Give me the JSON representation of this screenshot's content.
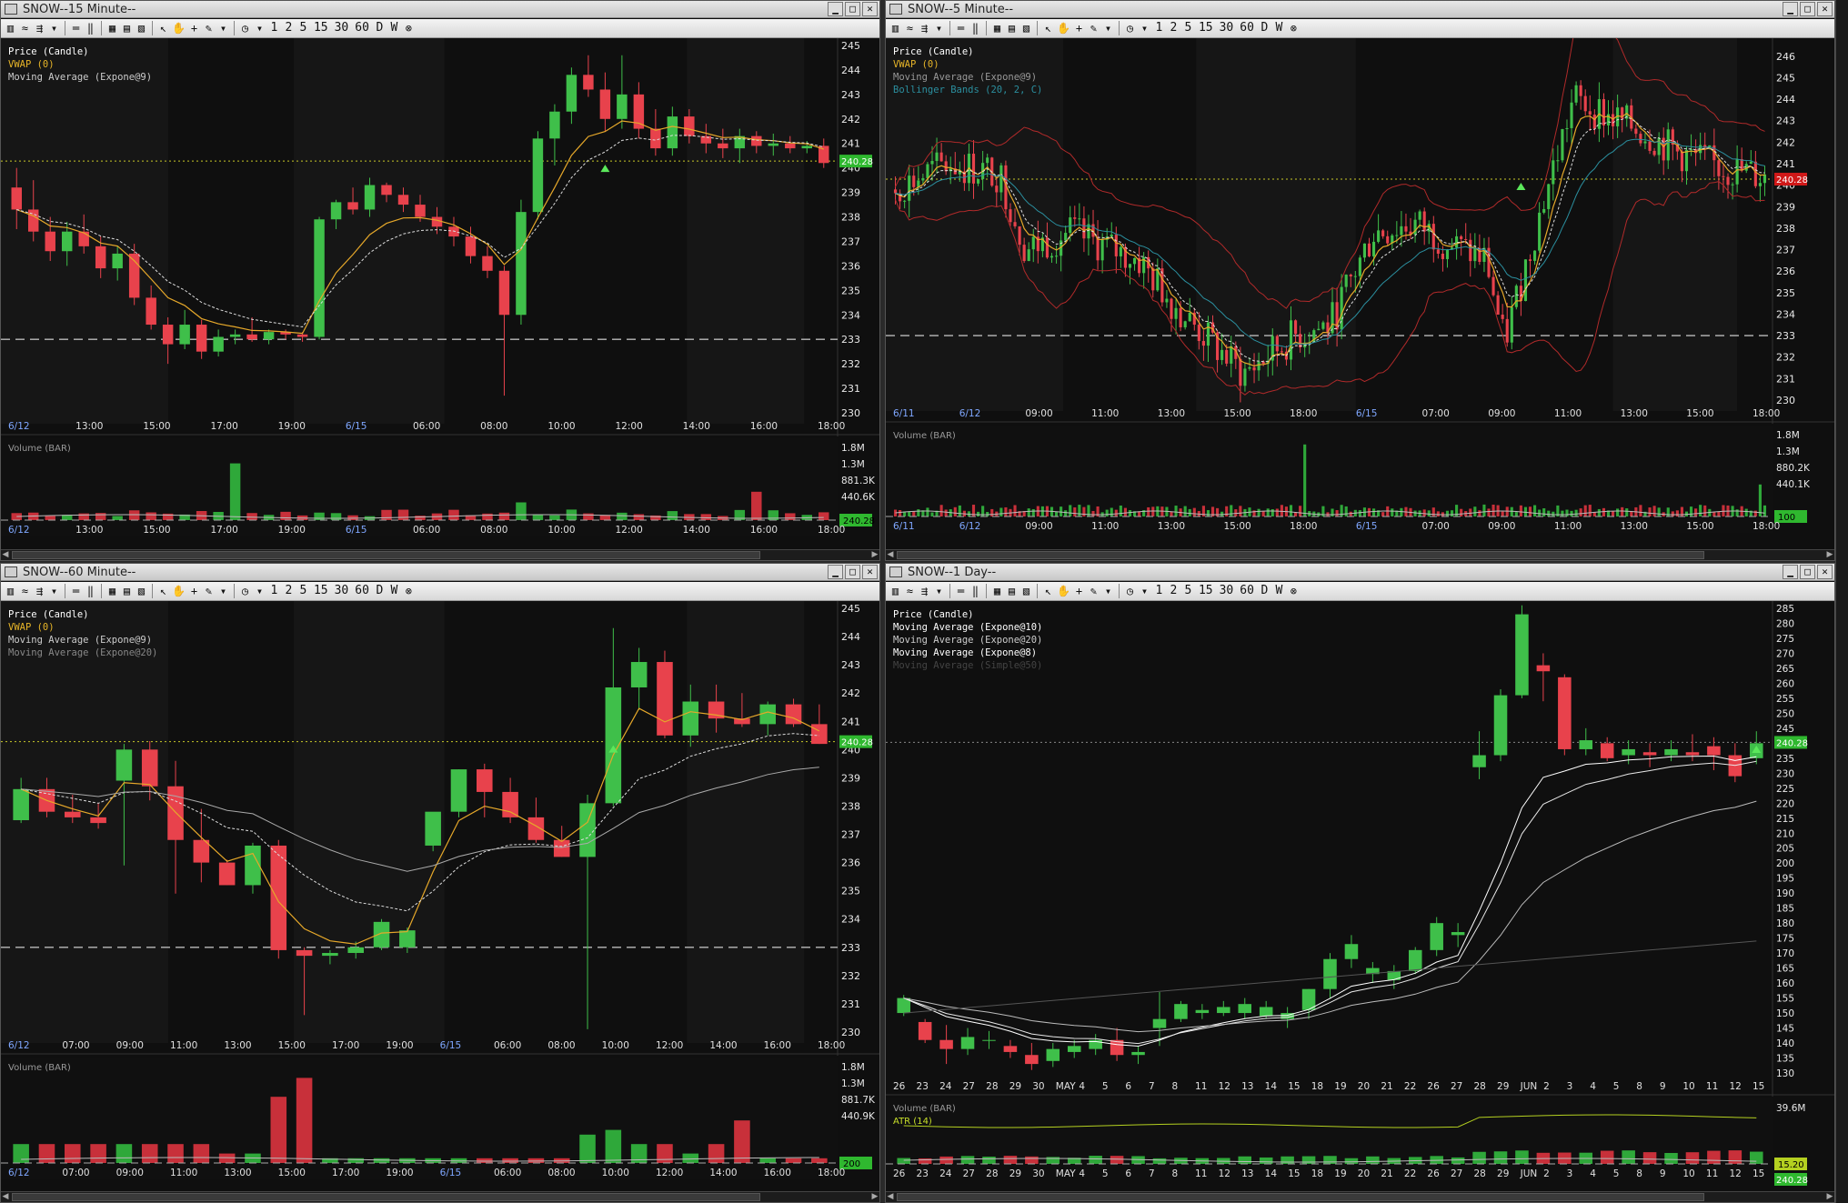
{
  "toolbar": {
    "intervals": [
      "1",
      "2",
      "5",
      "15",
      "30",
      "60",
      "D",
      "W"
    ]
  },
  "windows": [
    {
      "id": "w15",
      "title": "SNOW--15 Minute--",
      "legend": [
        {
          "text": "Price (Candle)",
          "color": "#ffffff"
        },
        {
          "text": "VWAP (0)",
          "color": "#e6b428"
        },
        {
          "text": "Moving Average (Expone@9)",
          "color": "#cccccc"
        }
      ],
      "price_labels": [
        "245",
        "244",
        "243",
        "242",
        "241",
        "240",
        "239",
        "238",
        "237",
        "236",
        "235",
        "234",
        "233",
        "232",
        "231",
        "230"
      ],
      "price_tag": "240.28",
      "time_labels": [
        "6/12",
        "13:00",
        "15:00",
        "17:00",
        "19:00",
        "6/15",
        "06:00",
        "08:00",
        "10:00",
        "12:00",
        "14:00",
        "16:00",
        "18:00"
      ],
      "volume_title": "Volume (BAR)",
      "volume_labels": [
        "1.8M",
        "1.3M",
        "881.3K",
        "440.6K"
      ],
      "volume_tag": "240.28"
    },
    {
      "id": "w5",
      "title": "SNOW--5 Minute--",
      "legend": [
        {
          "text": "Price (Candle)",
          "color": "#ffffff"
        },
        {
          "text": "VWAP (0)",
          "color": "#e6b428"
        },
        {
          "text": "Moving Average (Expone@9)",
          "color": "#999999"
        },
        {
          "text": "Bollinger Bands (20, 2, C)",
          "color": "#2b8f9f"
        }
      ],
      "price_labels": [
        "246",
        "245",
        "244",
        "243",
        "242",
        "241",
        "240",
        "239",
        "238",
        "237",
        "236",
        "235",
        "234",
        "233",
        "232",
        "231",
        "230"
      ],
      "price_tag": "240.28",
      "time_labels": [
        "6/11",
        "6/12",
        "09:00",
        "11:00",
        "13:00",
        "15:00",
        "18:00",
        "6/15",
        "07:00",
        "09:00",
        "11:00",
        "13:00",
        "15:00",
        "18:00"
      ],
      "volume_title": "Volume (BAR)",
      "volume_labels": [
        "1.8M",
        "1.3M",
        "880.2K",
        "440.1K"
      ],
      "volume_tag": "100"
    },
    {
      "id": "w60",
      "title": "SNOW--60 Minute--",
      "legend": [
        {
          "text": "Price (Candle)",
          "color": "#ffffff"
        },
        {
          "text": "VWAP (0)",
          "color": "#e6b428"
        },
        {
          "text": "Moving Average (Expone@9)",
          "color": "#cccccc"
        },
        {
          "text": "Moving Average (Expone@20)",
          "color": "#888888"
        }
      ],
      "price_labels": [
        "245",
        "244",
        "243",
        "242",
        "241",
        "240",
        "239",
        "238",
        "237",
        "236",
        "235",
        "234",
        "233",
        "232",
        "231",
        "230"
      ],
      "price_tag": "240.28",
      "time_labels": [
        "6/12",
        "07:00",
        "09:00",
        "11:00",
        "13:00",
        "15:00",
        "17:00",
        "19:00",
        "6/15",
        "06:00",
        "08:00",
        "10:00",
        "12:00",
        "14:00",
        "16:00",
        "18:00"
      ],
      "volume_title": "Volume (BAR)",
      "volume_labels": [
        "1.8M",
        "1.3M",
        "881.7K",
        "440.9K"
      ],
      "volume_tag": "200"
    },
    {
      "id": "wD",
      "title": "SNOW--1 Day--",
      "legend": [
        {
          "text": "Price (Candle)",
          "color": "#ffffff"
        },
        {
          "text": "Moving Average (Expone@10)",
          "color": "#ffffff"
        },
        {
          "text": "Moving Average (Expone@20)",
          "color": "#cccccc"
        },
        {
          "text": "Moving Average (Expone@8)",
          "color": "#ffffff"
        },
        {
          "text": "Moving Average (Simple@50)",
          "color": "#444444"
        }
      ],
      "price_labels": [
        "285",
        "280",
        "275",
        "270",
        "265",
        "260",
        "255",
        "250",
        "245",
        "240",
        "235",
        "230",
        "225",
        "220",
        "215",
        "210",
        "205",
        "200",
        "195",
        "190",
        "185",
        "180",
        "175",
        "170",
        "165",
        "160",
        "155",
        "150",
        "145",
        "140",
        "135",
        "130"
      ],
      "price_tag": "240.28",
      "time_labels": [
        "26",
        "23",
        "24",
        "27",
        "28",
        "29",
        "30",
        "MAY",
        "4",
        "5",
        "6",
        "7",
        "8",
        "11",
        "12",
        "13",
        "14",
        "15",
        "18",
        "19",
        "20",
        "21",
        "22",
        "26",
        "27",
        "28",
        "29",
        "JUN",
        "2",
        "3",
        "4",
        "5",
        "8",
        "9",
        "10",
        "11",
        "12",
        "15"
      ],
      "volume_title": "Volume (BAR)",
      "atr_label": "ATR (14)",
      "volume_labels": [
        "39.6M"
      ],
      "volume_tag": "15.20",
      "atr_tag": "240.28"
    }
  ],
  "chart_data": [
    {
      "type": "candlestick",
      "title": "SNOW--15 Minute--",
      "ylim": [
        230,
        245
      ],
      "hlines": [
        240.28,
        233
      ],
      "candles": [
        [
          239.2,
          240.0,
          237.5,
          238.3
        ],
        [
          238.3,
          239.5,
          237.0,
          237.4
        ],
        [
          237.4,
          238.0,
          236.2,
          236.6
        ],
        [
          236.6,
          237.8,
          236.0,
          237.4
        ],
        [
          237.4,
          238.1,
          236.5,
          236.8
        ],
        [
          236.8,
          237.2,
          235.5,
          235.9
        ],
        [
          235.9,
          236.8,
          235.4,
          236.5
        ],
        [
          236.5,
          236.9,
          234.4,
          234.7
        ],
        [
          234.7,
          235.2,
          233.4,
          233.6
        ],
        [
          233.6,
          233.9,
          232.0,
          232.8
        ],
        [
          232.8,
          234.2,
          232.6,
          233.6
        ],
        [
          233.6,
          233.8,
          232.2,
          232.5
        ],
        [
          232.5,
          233.4,
          232.3,
          233.1
        ],
        [
          233.1,
          233.4,
          232.8,
          233.2
        ],
        [
          233.2,
          233.9,
          232.9,
          233.0
        ],
        [
          233.0,
          233.4,
          232.8,
          233.3
        ],
        [
          233.3,
          233.4,
          233.0,
          233.2
        ],
        [
          233.2,
          233.3,
          232.9,
          233.1
        ],
        [
          233.1,
          238.0,
          233.0,
          237.9
        ],
        [
          237.9,
          238.7,
          237.5,
          238.6
        ],
        [
          238.6,
          239.2,
          238.1,
          238.3
        ],
        [
          238.3,
          239.6,
          238.0,
          239.3
        ],
        [
          239.3,
          239.4,
          238.6,
          238.9
        ],
        [
          238.9,
          239.2,
          238.2,
          238.5
        ],
        [
          238.5,
          238.9,
          237.8,
          238.0
        ],
        [
          238.0,
          238.4,
          237.3,
          237.6
        ],
        [
          237.6,
          238.0,
          236.8,
          237.2
        ],
        [
          237.2,
          237.6,
          236.1,
          236.4
        ],
        [
          236.4,
          236.8,
          235.5,
          235.8
        ],
        [
          235.8,
          236.0,
          230.7,
          234.0
        ],
        [
          234.0,
          238.7,
          233.6,
          238.2
        ],
        [
          238.2,
          241.5,
          237.9,
          241.2
        ],
        [
          241.2,
          242.6,
          240.1,
          242.3
        ],
        [
          242.3,
          244.1,
          241.8,
          243.8
        ],
        [
          243.8,
          244.6,
          242.9,
          243.2
        ],
        [
          243.2,
          243.9,
          241.5,
          242.0
        ],
        [
          242.0,
          244.6,
          241.6,
          243.0
        ],
        [
          243.0,
          243.5,
          241.2,
          241.6
        ],
        [
          241.6,
          242.4,
          240.5,
          240.8
        ],
        [
          240.8,
          242.5,
          240.5,
          242.1
        ],
        [
          242.1,
          242.4,
          241.0,
          241.3
        ],
        [
          241.3,
          241.8,
          240.6,
          241.0
        ],
        [
          241.0,
          241.6,
          240.4,
          240.8
        ],
        [
          240.8,
          241.6,
          240.2,
          241.3
        ],
        [
          241.3,
          241.5,
          240.6,
          240.9
        ],
        [
          240.9,
          241.4,
          240.5,
          241.0
        ],
        [
          241.0,
          241.3,
          240.6,
          240.8
        ],
        [
          240.8,
          241.1,
          240.6,
          240.9
        ],
        [
          240.9,
          241.2,
          240.0,
          240.2
        ]
      ]
    },
    {
      "type": "candlestick",
      "title": "SNOW--5 Minute--",
      "ylim": [
        230,
        246.5
      ],
      "hlines": [
        240.28,
        233
      ]
    },
    {
      "type": "candlestick",
      "title": "SNOW--60 Minute--",
      "ylim": [
        230,
        245
      ],
      "hlines": [
        240.28,
        233
      ],
      "candles": [
        [
          237.5,
          239.0,
          237.4,
          238.6
        ],
        [
          238.6,
          239.0,
          237.6,
          237.8
        ],
        [
          237.8,
          238.4,
          237.4,
          237.6
        ],
        [
          237.6,
          238.1,
          237.2,
          237.4
        ],
        [
          238.9,
          240.2,
          235.9,
          240.0
        ],
        [
          240.0,
          240.3,
          238.2,
          238.7
        ],
        [
          238.7,
          239.6,
          234.9,
          236.8
        ],
        [
          236.8,
          237.9,
          235.3,
          236.0
        ],
        [
          236.0,
          236.1,
          235.2,
          235.2
        ],
        [
          235.2,
          236.7,
          234.9,
          236.6
        ],
        [
          236.6,
          236.8,
          232.6,
          232.9
        ],
        [
          232.9,
          233.0,
          230.6,
          232.7
        ],
        [
          232.7,
          232.9,
          232.4,
          232.8
        ],
        [
          232.8,
          233.2,
          232.6,
          233.0
        ],
        [
          233.0,
          234.0,
          232.9,
          233.9
        ],
        [
          233.0,
          233.7,
          232.8,
          233.6
        ],
        [
          236.6,
          237.6,
          236.4,
          237.8
        ],
        [
          237.8,
          239.3,
          237.6,
          239.3
        ],
        [
          239.3,
          239.5,
          237.6,
          238.5
        ],
        [
          238.5,
          239.0,
          237.4,
          237.6
        ],
        [
          237.6,
          238.3,
          236.7,
          236.8
        ],
        [
          236.8,
          237.3,
          236.2,
          236.2
        ],
        [
          236.2,
          238.4,
          230.1,
          238.1
        ],
        [
          238.1,
          244.3,
          238.0,
          242.2
        ],
        [
          242.2,
          243.6,
          241.4,
          243.1
        ],
        [
          243.1,
          243.5,
          240.4,
          240.5
        ],
        [
          240.5,
          242.3,
          240.1,
          241.7
        ],
        [
          241.7,
          242.3,
          240.6,
          241.1
        ],
        [
          241.1,
          242.0,
          240.8,
          240.9
        ],
        [
          240.9,
          241.7,
          240.5,
          241.6
        ],
        [
          241.6,
          241.8,
          240.8,
          240.9
        ],
        [
          240.9,
          241.6,
          240.2,
          240.2
        ]
      ]
    },
    {
      "type": "candlestick",
      "title": "SNOW--1 Day--",
      "ylim": [
        130,
        285
      ],
      "hlines": [
        240.28
      ],
      "candles": [
        [
          150,
          156,
          149,
          155
        ],
        [
          147,
          148,
          140,
          141
        ],
        [
          141,
          146,
          133,
          138
        ],
        [
          138,
          145,
          136,
          142
        ],
        [
          141,
          144,
          138,
          141
        ],
        [
          139,
          141,
          135,
          137
        ],
        [
          136,
          140,
          131,
          133
        ],
        [
          134,
          140,
          132,
          138
        ],
        [
          137,
          141,
          135,
          139
        ],
        [
          138,
          143,
          136,
          141
        ],
        [
          141,
          145,
          134,
          136
        ],
        [
          136,
          139,
          133,
          137
        ],
        [
          145,
          157,
          139,
          148
        ],
        [
          148,
          154,
          147,
          153
        ],
        [
          150,
          153,
          148,
          151
        ],
        [
          150,
          154,
          149,
          152
        ],
        [
          150,
          155,
          148,
          153
        ],
        [
          149,
          154,
          148,
          152
        ],
        [
          148,
          152,
          145,
          150
        ],
        [
          151,
          158,
          148,
          158
        ],
        [
          158,
          170,
          155,
          168
        ],
        [
          168,
          176,
          165,
          173
        ],
        [
          163,
          167,
          160,
          165
        ],
        [
          161,
          166,
          158,
          164
        ],
        [
          164,
          172,
          163,
          171
        ],
        [
          171,
          182,
          169,
          180
        ],
        [
          176,
          180,
          172,
          177
        ],
        [
          232,
          244,
          228,
          236
        ],
        [
          236,
          258,
          234,
          256
        ],
        [
          256,
          286,
          255,
          283
        ],
        [
          266,
          270,
          254,
          264
        ],
        [
          262,
          263,
          236,
          238
        ],
        [
          238,
          245,
          236,
          241
        ],
        [
          240,
          242,
          234,
          235
        ],
        [
          236,
          241,
          233,
          238
        ],
        [
          237,
          240,
          232,
          236
        ],
        [
          236,
          241,
          234,
          238
        ],
        [
          237,
          243,
          234,
          236
        ],
        [
          239,
          242,
          231,
          236
        ],
        [
          236,
          240,
          227,
          229
        ],
        [
          235,
          244,
          233,
          240
        ]
      ]
    }
  ]
}
